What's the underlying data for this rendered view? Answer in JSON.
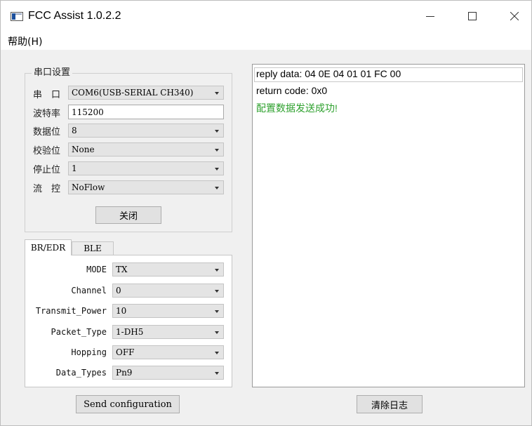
{
  "window": {
    "title": "FCC Assist 1.0.2.2",
    "icon": "app-window-icon",
    "controls": {
      "minimize": "minimize-icon",
      "maximize": "maximize-icon",
      "close": "close-icon"
    }
  },
  "menu": {
    "help": "帮助(H)"
  },
  "serial": {
    "group_title": "串口设置",
    "port_label": "串　口",
    "port_value": "COM6(USB-SERIAL CH340)",
    "baud_label": "波特率",
    "baud_value": "115200",
    "databits_label": "数据位",
    "databits_value": "8",
    "parity_label": "校验位",
    "parity_value": "None",
    "stopbits_label": "停止位",
    "stopbits_value": "1",
    "flow_label": "流　控",
    "flow_value": "NoFlow",
    "close_button": "关闭"
  },
  "tabs": [
    {
      "label": "BR/EDR",
      "active": true
    },
    {
      "label": "BLE",
      "active": false
    }
  ],
  "bredr": {
    "fields": [
      {
        "label": "MODE",
        "value": "TX"
      },
      {
        "label": "Channel",
        "value": "0"
      },
      {
        "label": "Transmit_Power",
        "value": "10"
      },
      {
        "label": "Packet_Type",
        "value": "1-DH5"
      },
      {
        "label": "Hopping",
        "value": "OFF"
      },
      {
        "label": "Data_Types",
        "value": "Pn9"
      }
    ]
  },
  "actions": {
    "send": "Send configuration",
    "clear_log": "清除日志"
  },
  "log": {
    "lines": [
      {
        "text": "reply data: 04 0E 04 01 01 FC 00",
        "color": "#000000"
      },
      {
        "text": "return code: 0x0",
        "color": "#000000"
      },
      {
        "text": "配置数据发送成功!",
        "color": "#2ea12e"
      }
    ]
  },
  "colors": {
    "success": "#2ea12e"
  }
}
